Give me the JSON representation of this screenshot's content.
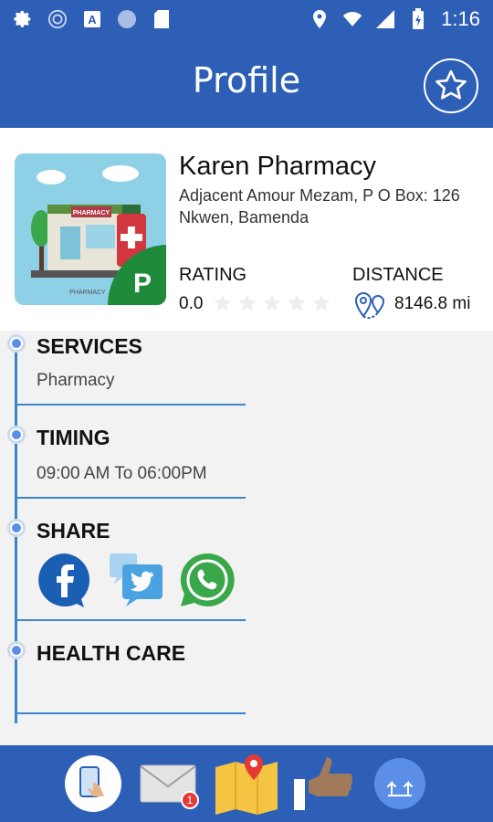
{
  "status_bar": {
    "time": "1:16",
    "left_icons": [
      "settings-icon",
      "sync-icon",
      "a-icon",
      "circle-icon",
      "sd-card-icon"
    ],
    "right_icons": [
      "location-icon",
      "wifi-icon",
      "signal-icon",
      "battery-icon"
    ]
  },
  "appbar": {
    "title": "Profile",
    "favorite_icon": "star-icon"
  },
  "pharmacy": {
    "name": "Karen Pharmacy",
    "address": "Adjacent Amour Mezam, P O Box:  126 Nkwen, Bamenda",
    "image_sign": "PHARMACY",
    "image_caption": "PHARMACY",
    "image_badge": "P",
    "rating_label": "RATING",
    "rating_value": "0.0",
    "rating": 0,
    "rating_max": 5,
    "distance_label": "DISTANCE",
    "distance_value": "8146.8 mi"
  },
  "sections": {
    "services": {
      "title": "SERVICES",
      "value": "Pharmacy"
    },
    "timing": {
      "title": "TIMING",
      "value": "09:00 AM To 06:00PM"
    },
    "share": {
      "title": "SHARE",
      "icons": [
        "facebook-icon",
        "twitter-icon",
        "whatsapp-icon"
      ]
    },
    "health_care": {
      "title": "HEALTH CARE"
    }
  },
  "bottom_nav": {
    "items": [
      "touch-phone-icon",
      "mail-icon",
      "map-icon",
      "thumbs-up-icon",
      "upload-icon"
    ],
    "mail_badge": "1"
  },
  "colors": {
    "primary": "#2d5fb6",
    "timeline": "#3a86c8",
    "facebook": "#1a5fb4",
    "twitter": "#4aa3e0",
    "whatsapp": "#3aa84a"
  }
}
